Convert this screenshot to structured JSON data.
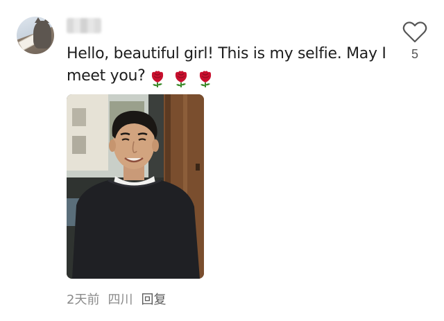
{
  "comment": {
    "text": "Hello, beautiful girl! This is my selfie. May I meet you?",
    "emoji": [
      "rose-emoji",
      "rose-emoji",
      "rose-emoji"
    ],
    "likes": "5",
    "time": "2天前",
    "location": "四川",
    "reply_label": "回复"
  },
  "icons": {
    "like": "heart-outline-icon",
    "rose": "rose-icon"
  },
  "colors": {
    "text": "#1d1d1d",
    "meta": "#8a8a8a",
    "heart_stroke": "#555555",
    "rose": "#c8102e"
  }
}
